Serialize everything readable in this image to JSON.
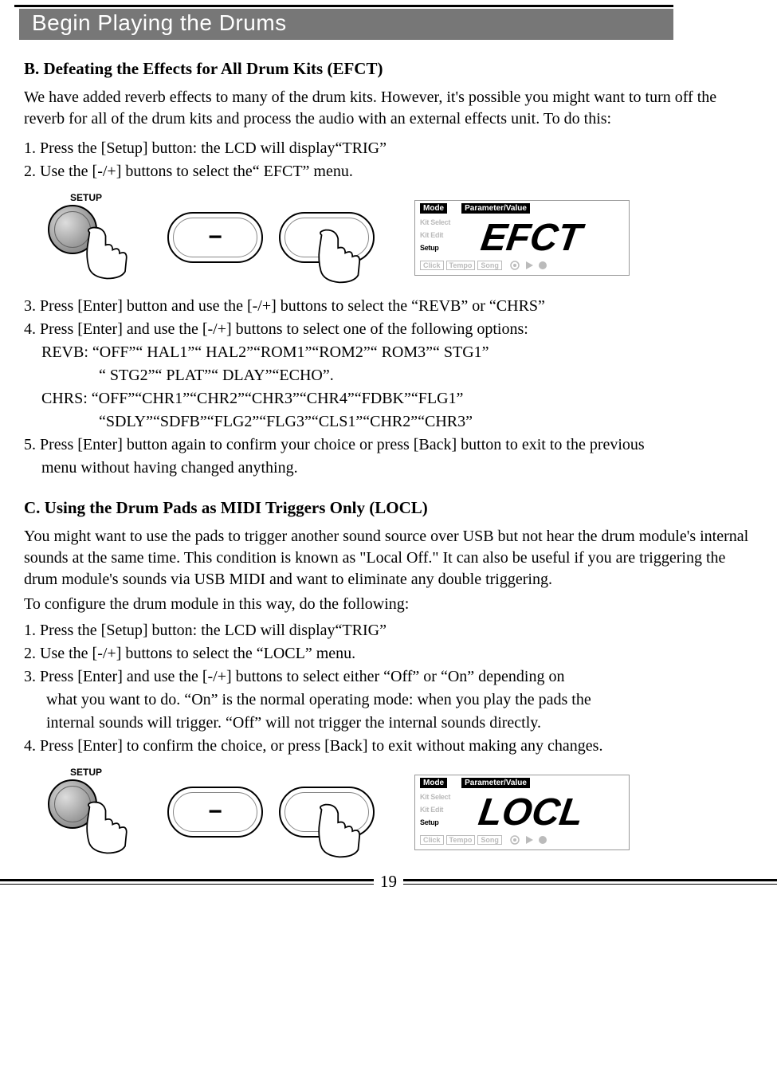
{
  "header": {
    "title": "Begin Playing the Drums"
  },
  "sectionB": {
    "heading": "B. Defeating the Effects for All Drum Kits (EFCT)",
    "intro": "We have added reverb effects to many of the drum kits. However, it's possible you might want to turn off the reverb for all of the drum kits and process the audio with an external effects unit. To do this:",
    "step1": "1. Press the [Setup] button: the LCD will display“TRIG”",
    "step2": "2. Use the [-/+] buttons to select the“ EFCT” menu.",
    "step3": "3. Press [Enter] button and use the [-/+] buttons to select  the “REVB” or “CHRS”",
    "step4": "4. Press [Enter] and use the [-/+] buttons to select one of the following options:",
    "revb_line1": "REVB: “OFF”“ HAL1”“ HAL2”“ROM1”“ROM2”“ ROM3”“ STG1”",
    "revb_line2": "“ STG2”“ PLAT”“ DLAY”“ECHO”.",
    "chrs_line1": "CHRS: “OFF”“CHR1”“CHR2”“CHR3”“CHR4”“FDBK”“FLG1”",
    "chrs_line2": "“SDLY”“SDFB”“FLG2”“FLG3”“CLS1”“CHR2”“CHR3”",
    "step5a": "5. Press [Enter] button again to confirm your choice or press [Back] button to exit to the previous",
    "step5b": "menu without having changed anything."
  },
  "sectionC": {
    "heading": "C. Using the Drum Pads as MIDI Triggers Only (LOCL)",
    "intro": "You might want to use the pads to trigger another sound source over USB but not hear the drum module's internal sounds at the same time. This condition is known as \"Local Off.\" It can also be useful if you are triggering the drum module's sounds via USB MIDI and want to eliminate any double triggering.",
    "intro2": "To configure the drum module in this way, do the following:",
    "step1": "1. Press the [Setup] button: the LCD will display“TRIG”",
    "step2": "2. Use the [-/+] buttons to select the “LOCL” menu.",
    "step3a": "3. Press [Enter] and use the [-/+] buttons to select either “Off” or “On” depending on",
    "step3b": "what you want to do. “On” is the normal operating mode: when you play the pads the",
    "step3c": "internal sounds will trigger. “Off” will not trigger the internal sounds directly.",
    "step4": "4. Press [Enter] to confirm the choice, or press [Back] to exit without making any changes."
  },
  "buttons": {
    "setup_label": "SETUP",
    "minus": "−",
    "plus": "+"
  },
  "lcd": {
    "mode_label": "Mode",
    "param_label": "Parameter/Value",
    "kit_select": "Kit Select",
    "kit_edit": "Kit Edit",
    "setup": "Setup",
    "click": "Click",
    "tempo": "Tempo",
    "song": "Song",
    "display1_text": "EFCT",
    "display2_text": "LOCL"
  },
  "page_number": "19"
}
